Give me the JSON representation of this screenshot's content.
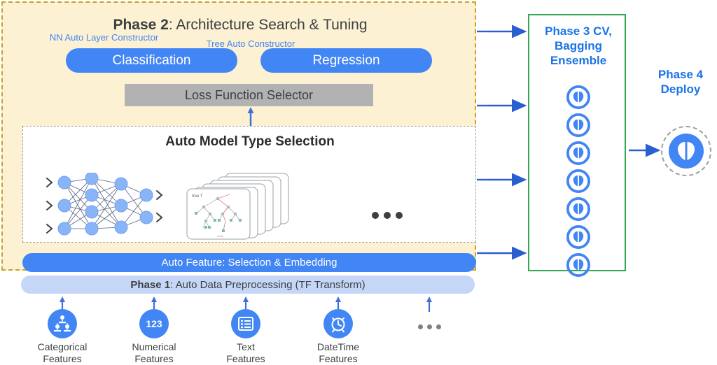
{
  "diagram": {
    "phase2": {
      "title_bold": "Phase 2",
      "title_rest": ": Architecture Search & Tuning",
      "pills": [
        {
          "label": "Classification"
        },
        {
          "label": "Regression"
        }
      ],
      "loss_selector": "Loss Function Selector",
      "model_box": {
        "title": "Auto Model Type Selection",
        "nn_caption": "NN Auto Layer Constructor",
        "tree_caption": "Tree Auto Constructor",
        "tree_label": "tree T",
        "ellipsis": "•••"
      },
      "auto_feature_bar": "Auto Feature: Selection & Embedding"
    },
    "phase1": {
      "title_bold": "Phase 1",
      "title_rest": ": Auto Data Preprocessing (TF Transform)",
      "features": [
        {
          "label_line1": "Categorical",
          "label_line2": "Features",
          "icon": "hierarchy-icon"
        },
        {
          "label_line1": "Numerical",
          "label_line2": "Features",
          "icon": "numeric-123-icon"
        },
        {
          "label_line1": "Text",
          "label_line2": "Features",
          "icon": "list-lines-icon"
        },
        {
          "label_line1": "DateTime",
          "label_line2": "Features",
          "icon": "alarm-clock-icon"
        }
      ],
      "numeric_glyph": "123",
      "ellipsis": "•••"
    },
    "phase3": {
      "title_line1": "Phase 3 CV,",
      "title_line2": "Bagging",
      "title_line3": "Ensemble",
      "model_count": 7,
      "icon": "brain-icon"
    },
    "phase4": {
      "title_line1": "Phase 4",
      "title_line2": "Deploy",
      "icon": "brain-icon"
    },
    "colors": {
      "accent_blue": "#4285f4",
      "title_blue": "#1a73e8",
      "panel_cream": "#fdf1d3",
      "panel_border": "#c9a227",
      "phase1_bar": "#c5d6f7",
      "loss_gray": "#b2b2b2",
      "phase3_border": "#34a853",
      "text_dark": "#3c4043"
    }
  }
}
